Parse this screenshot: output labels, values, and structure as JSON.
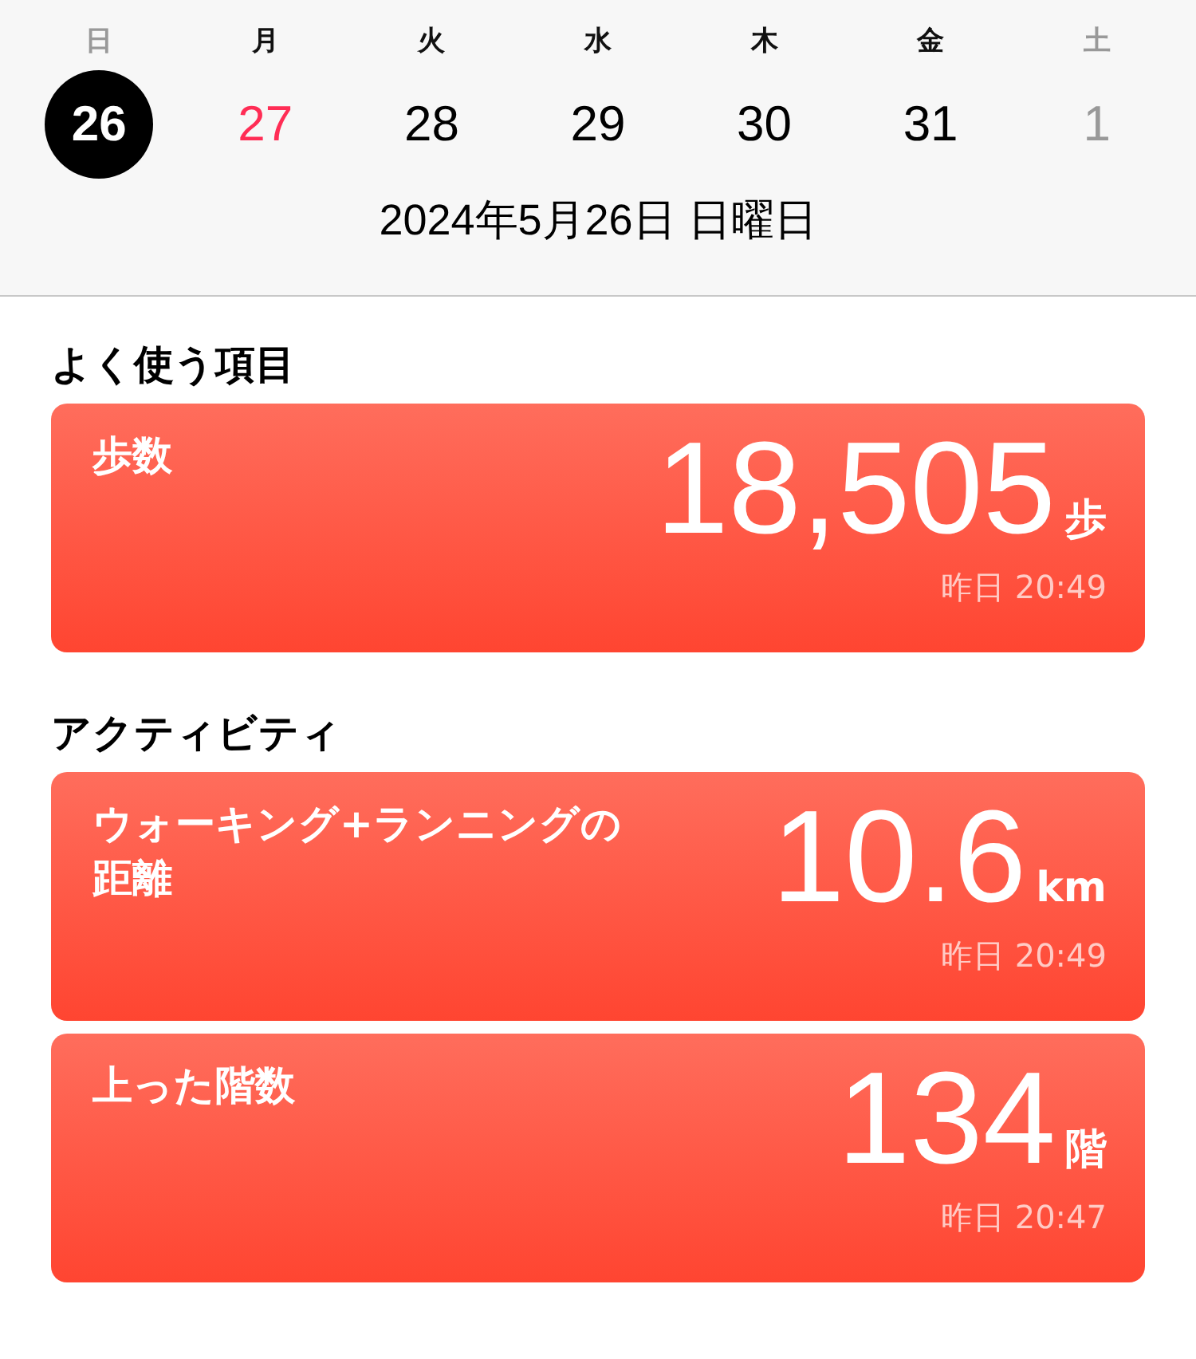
{
  "week": {
    "weekdays": [
      {
        "label": "日",
        "weekend": true
      },
      {
        "label": "月",
        "weekend": false
      },
      {
        "label": "火",
        "weekend": false
      },
      {
        "label": "水",
        "weekend": false
      },
      {
        "label": "木",
        "weekend": false
      },
      {
        "label": "金",
        "weekend": false
      },
      {
        "label": "土",
        "weekend": true
      }
    ],
    "days": [
      {
        "label": "26",
        "selected": true,
        "kind": "current"
      },
      {
        "label": "27",
        "selected": false,
        "kind": "today"
      },
      {
        "label": "28",
        "selected": false,
        "kind": "current"
      },
      {
        "label": "29",
        "selected": false,
        "kind": "current"
      },
      {
        "label": "30",
        "selected": false,
        "kind": "current"
      },
      {
        "label": "31",
        "selected": false,
        "kind": "current"
      },
      {
        "label": "1",
        "selected": false,
        "kind": "other_month"
      }
    ],
    "date_title": "2024年5月26日 日曜日"
  },
  "sections": [
    {
      "title": "よく使う項目",
      "cards": [
        {
          "title": "歩数",
          "value": "18,505",
          "unit": "歩",
          "time": "昨日 20:49"
        }
      ]
    },
    {
      "title": "アクティビティ",
      "cards": [
        {
          "title": "ウォーキング+ランニングの距離",
          "value": "10.6",
          "unit": "km",
          "time": "昨日 20:49"
        },
        {
          "title": "上った階数",
          "value": "134",
          "unit": "階",
          "time": "昨日 20:47"
        }
      ]
    }
  ]
}
